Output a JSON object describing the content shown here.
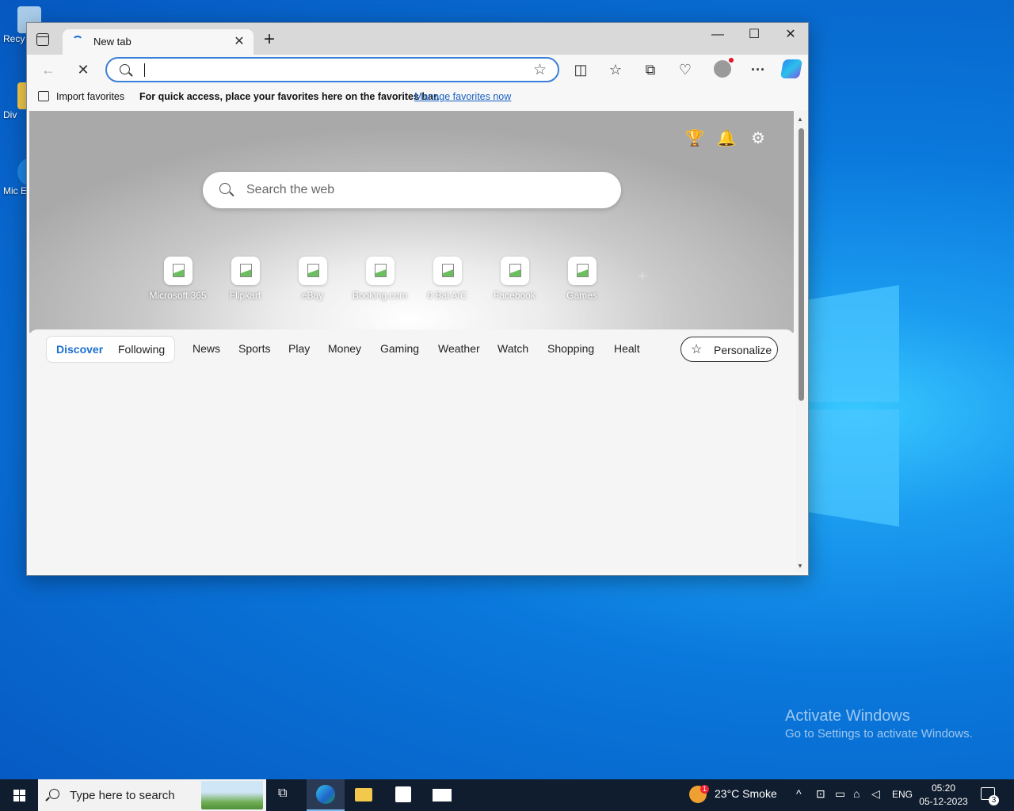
{
  "desktop": {
    "icons": [
      {
        "label": "Recy",
        "color": "#9fc9ea"
      },
      {
        "label": "Div",
        "color": "#f2c94c"
      },
      {
        "label": "Mic E",
        "color": "#1e88e5"
      }
    ],
    "activate_title": "Activate Windows",
    "activate_sub": "Go to Settings to activate Windows."
  },
  "browser": {
    "tab_title": "New tab",
    "tab_close": "✕",
    "new_tab": "+",
    "window_controls": {
      "minimize": "—",
      "maximize": "☐",
      "close": "✕"
    },
    "nav": {
      "back": "←",
      "stop": "✕"
    },
    "address": {
      "value": "",
      "star": "☆"
    },
    "toolbar_icons": {
      "split": "◫",
      "favorites": "☆",
      "collections": "⧉",
      "health": "♡",
      "more": "···"
    },
    "favbar": {
      "import_label": "Import favorites",
      "message": "For quick access, place your favorites here on the favorites bar.",
      "manage_link": "Manage favorites now"
    }
  },
  "ntp": {
    "icons": {
      "rewards": "🏆",
      "bell": "🔔",
      "gear": "⚙"
    },
    "search_placeholder": "Search the web",
    "quick_links": [
      "Microsoft 365",
      "Flipkart",
      "eBay",
      "Booking.com",
      "0 Bal A/C",
      "Facebook",
      "Games"
    ],
    "add_site": "+",
    "feed": {
      "discover": "Discover",
      "following": "Following",
      "categories": [
        "News",
        "Sports",
        "Play",
        "Money",
        "Gaming",
        "Weather",
        "Watch",
        "Shopping",
        "Healt"
      ],
      "personalize": "Personalize"
    }
  },
  "taskbar": {
    "search_placeholder": "Type here to search",
    "weather": "23°C  Smoke",
    "weather_badge": "1",
    "lang": "ENG",
    "time": "05:20",
    "date": "05-12-2023",
    "notif_count": "3"
  },
  "colors": {
    "accent": "#1a6fd0",
    "taskbar": "#101d2f",
    "link": "#1a5fc4"
  }
}
